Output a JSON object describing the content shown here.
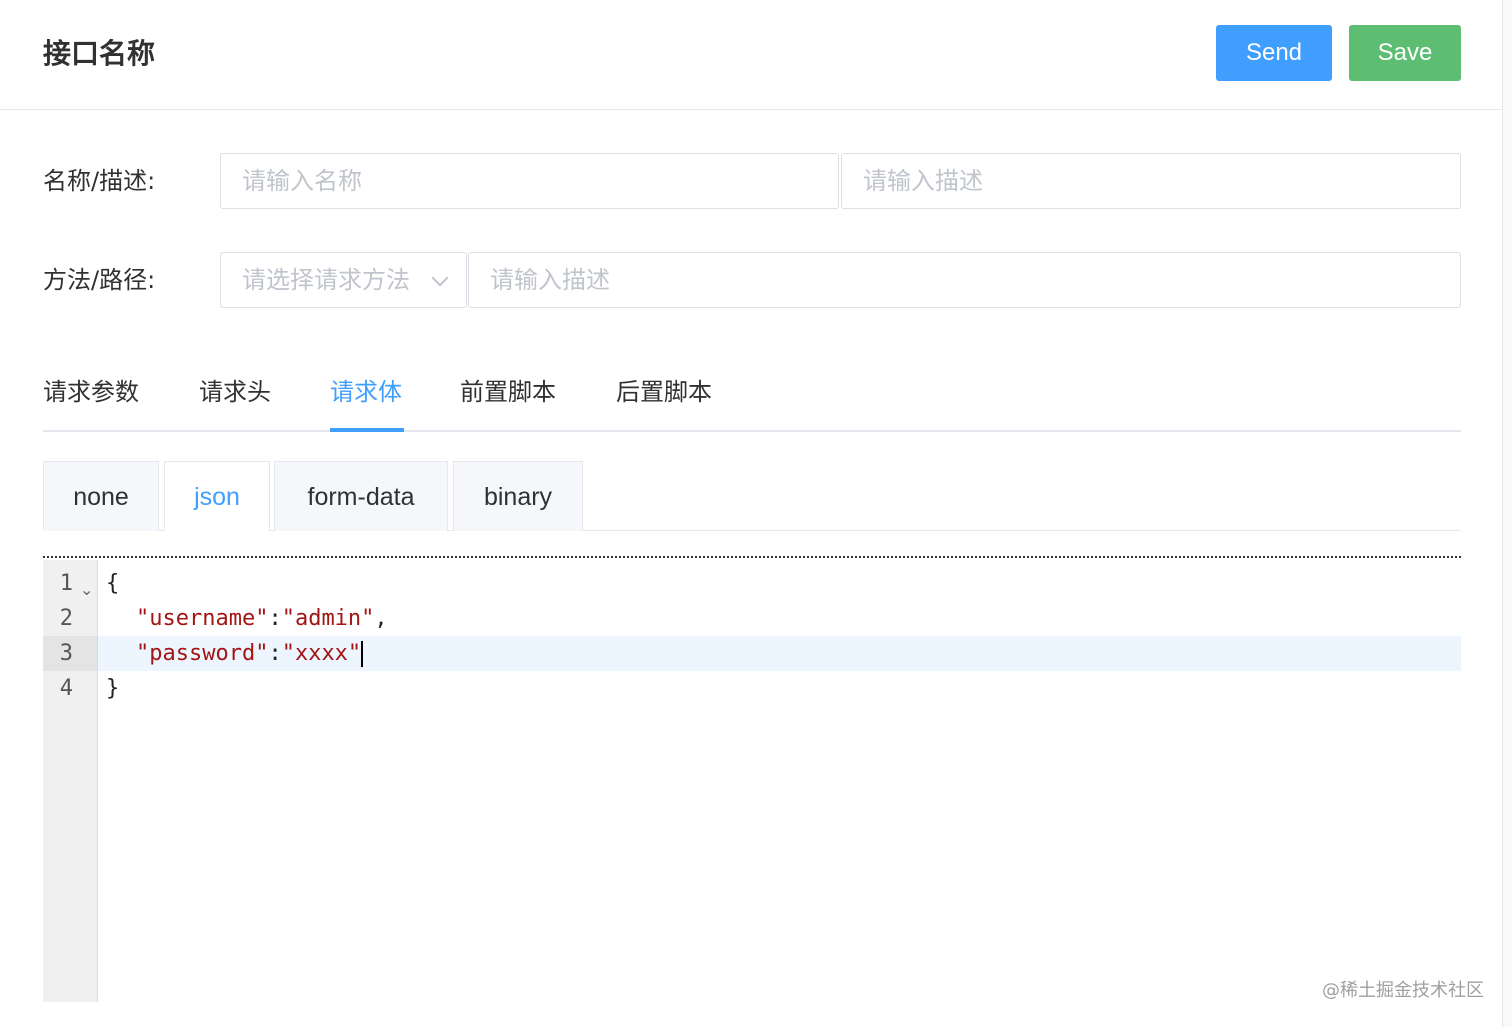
{
  "header": {
    "title": "接口名称",
    "send_label": "Send",
    "save_label": "Save"
  },
  "form": {
    "name_desc_label": "名称/描述:",
    "name_placeholder": "请输入名称",
    "desc_placeholder": "请输入描述",
    "method_path_label": "方法/路径:",
    "method_placeholder": "请选择请求方法",
    "path_placeholder": "请输入描述"
  },
  "tabs": [
    {
      "label": "请求参数",
      "active": false
    },
    {
      "label": "请求头",
      "active": false
    },
    {
      "label": "请求体",
      "active": true
    },
    {
      "label": "前置脚本",
      "active": false
    },
    {
      "label": "后置脚本",
      "active": false
    }
  ],
  "body_types": [
    {
      "label": "none",
      "active": false
    },
    {
      "label": "json",
      "active": true
    },
    {
      "label": "form-data",
      "active": false
    },
    {
      "label": "binary",
      "active": false
    }
  ],
  "editor": {
    "line_numbers": [
      "1",
      "2",
      "3",
      "4"
    ],
    "lines": {
      "l1": "{",
      "l2_key": "\"username\"",
      "l2_sep": ":",
      "l2_val": "\"admin\"",
      "l2_end": ",",
      "l3_key": "\"password\"",
      "l3_sep": ":",
      "l3_val": "\"xxxx\"",
      "l4": "}"
    }
  },
  "watermark": "@稀土掘金技术社区",
  "colors": {
    "primary": "#409eff",
    "success": "#5cbd73",
    "string": "#a31515"
  }
}
